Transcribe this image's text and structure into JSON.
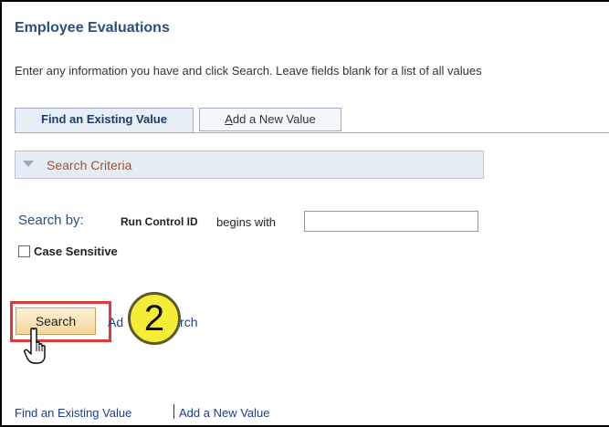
{
  "page": {
    "title": "Employee Evaluations",
    "instructions": "Enter any information you have and click Search. Leave fields blank for a list of all values"
  },
  "tabs": [
    {
      "label": "Find an Existing Value",
      "active": true
    },
    {
      "label": "Add a New Value",
      "active": false
    }
  ],
  "search_criteria": {
    "label": "Search Criteria"
  },
  "search_form": {
    "search_by_label": "Search by:",
    "field_label": "Run Control ID",
    "operator_label": "begins with",
    "input_value": "",
    "case_sensitive_label": "Case Sensitive",
    "case_sensitive_checked": false
  },
  "actions": {
    "search_label": "Search",
    "advanced_search_label": "Advanced Search",
    "advanced_visible_prefix": "Ad",
    "advanced_visible_suffix": "Search"
  },
  "callout": {
    "step_number": "2"
  },
  "footer": {
    "find_link": "Find an Existing Value",
    "add_link": "Add a New Value"
  },
  "colors": {
    "title": "#2c4f7c",
    "link": "#1f3d8f",
    "highlight": "#e03a3a",
    "badge": "#f4ec35"
  }
}
